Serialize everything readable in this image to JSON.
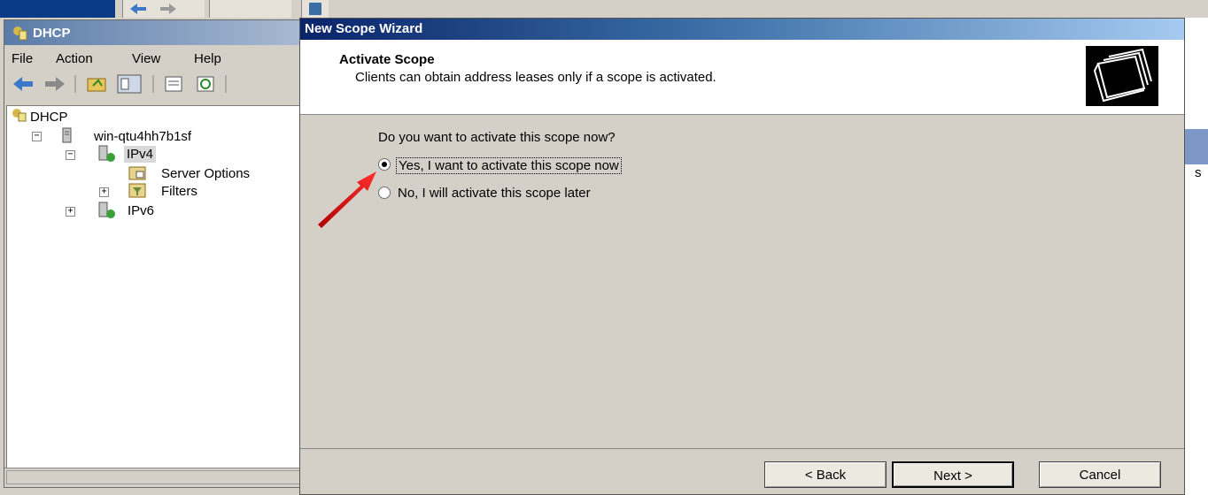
{
  "mmc": {
    "title": "DHCP",
    "menu": [
      "File",
      "Action",
      "View",
      "Help"
    ],
    "tree": {
      "root": "DHCP",
      "server": "win-qtu4hh7b1sf",
      "ipv4": "IPv4",
      "server_options": "Server Options",
      "filters": "Filters",
      "ipv6": "IPv6"
    }
  },
  "wizard": {
    "title": "New Scope Wizard",
    "header_title": "Activate Scope",
    "header_subtitle": "Clients can obtain address leases only if a scope is activated.",
    "question": "Do you want to activate this scope now?",
    "options": [
      {
        "label": "Yes, I want to activate this scope now",
        "selected": true
      },
      {
        "label": "No, I will activate this scope later",
        "selected": false
      }
    ],
    "buttons": {
      "back": "< Back",
      "next": "Next >",
      "cancel": "Cancel"
    }
  },
  "background": {
    "right_fragment": "s"
  },
  "colors": {
    "title_bar": "#0a246a",
    "panel": "#d4d0c8",
    "annotation_arrow": "#e01010"
  }
}
